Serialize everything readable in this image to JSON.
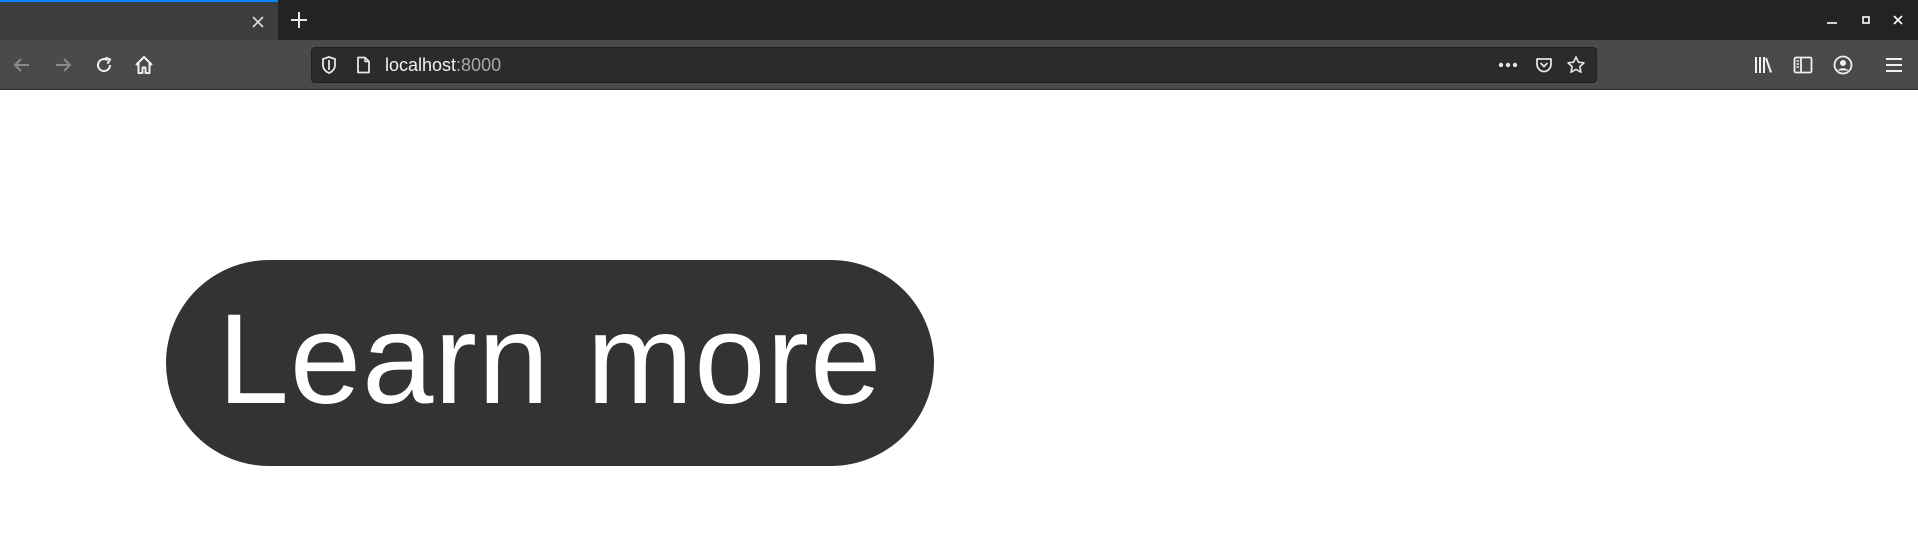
{
  "browser": {
    "tab": {
      "close_icon": "close-icon"
    },
    "toolbar": {
      "back_icon": "arrow-left-icon",
      "forward_icon": "arrow-right-icon",
      "reload_icon": "reload-icon",
      "home_icon": "home-icon"
    },
    "urlbar": {
      "host": "localhost",
      "port": ":8000",
      "tracking_icon": "shield-icon",
      "page_icon": "page-icon",
      "actions": [
        "more-icon",
        "pocket-icon",
        "star-icon"
      ]
    },
    "right_icons": [
      "library-icon",
      "sidebar-icon",
      "account-icon",
      "menu-icon"
    ],
    "window_controls": [
      "minimize-icon",
      "maximize-icon",
      "close-icon"
    ]
  },
  "page": {
    "button_label": "Learn more"
  },
  "colors": {
    "button_bg": "#333333",
    "button_text": "#ffffff",
    "tab_accent": "#0a84ff"
  }
}
